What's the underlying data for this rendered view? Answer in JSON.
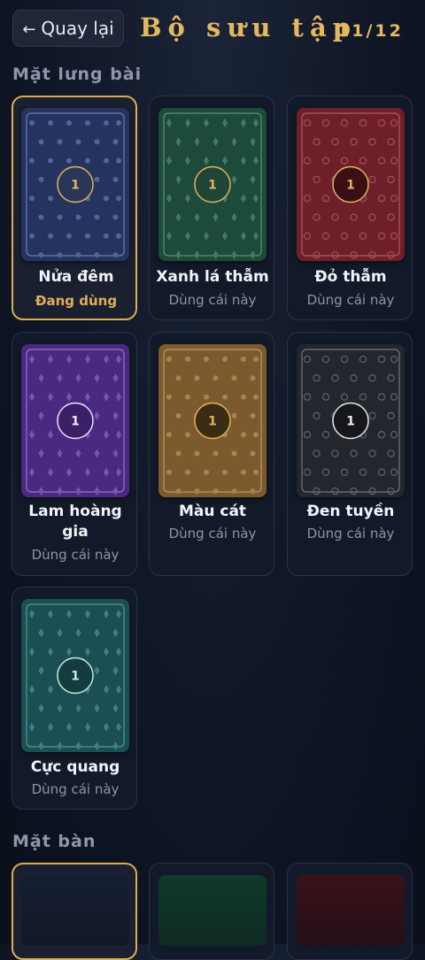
{
  "header": {
    "back_arrow": "←",
    "back_label": "Quay lại",
    "title": "Bộ sưu tập",
    "counter": "11/12"
  },
  "sections": {
    "card_backs": "Mặt lưng bài",
    "tables": "Mặt bàn"
  },
  "card_backs": [
    {
      "name": "Nửa đêm",
      "status": "Đang dùng",
      "emblem": "1",
      "pattern": "dot",
      "colors": {
        "bg": "#24345e",
        "pat": "#51659a",
        "border": "#6f86c4",
        "emblem_bg": "#2a3658",
        "emblem_ring": "#e0b45c",
        "emblem_text": "#e0b45c"
      }
    },
    {
      "name": "Xanh lá thẫm",
      "status": "Dùng cái này",
      "emblem": "1",
      "pattern": "diamond",
      "colors": {
        "bg": "#1e4a3a",
        "pat": "#3f7c63",
        "border": "#5e9b80",
        "emblem_bg": "#1f4536",
        "emblem_ring": "#e0b45c",
        "emblem_text": "#e0b45c"
      }
    },
    {
      "name": "Đỏ thẫm",
      "status": "Dùng cái này",
      "emblem": "1",
      "pattern": "ring",
      "colors": {
        "bg": "#6e1f2a",
        "pat": "#a14c57",
        "border": "#b8606b",
        "emblem_bg": "#3a1016",
        "emblem_ring": "#e0b45c",
        "emblem_text": "#e0b45c"
      }
    },
    {
      "name": "Lam hoàng gia",
      "status": "Dùng cái này",
      "emblem": "1",
      "pattern": "diamond",
      "colors": {
        "bg": "#4a2a80",
        "pat": "#7656ad",
        "border": "#9b80cf",
        "emblem_bg": "#3b2068",
        "emblem_ring": "#e8e2f4",
        "emblem_text": "#ece8f6"
      }
    },
    {
      "name": "Màu cát",
      "status": "Dùng cái này",
      "emblem": "1",
      "pattern": "dot",
      "colors": {
        "bg": "#7d5a2e",
        "pat": "#a88352",
        "border": "#c29f70",
        "emblem_bg": "#3a2c15",
        "emblem_ring": "#e0b45c",
        "emblem_text": "#e0b45c"
      }
    },
    {
      "name": "Đen tuyền",
      "status": "Dùng cái này",
      "emblem": "1",
      "pattern": "ring",
      "colors": {
        "bg": "#23262c",
        "pat": "#5b6068",
        "border": "#7a7f88",
        "emblem_bg": "#15171b",
        "emblem_ring": "#e6e8ec",
        "emblem_text": "#eceef2"
      }
    },
    {
      "name": "Cực quang",
      "status": "Dùng cái này",
      "emblem": "1",
      "pattern": "diamond",
      "colors": {
        "bg": "#1b4f53",
        "pat": "#3d8084",
        "border": "#5aa3a3",
        "emblem_bg": "#143b3e",
        "emblem_ring": "#bfeee8",
        "emblem_text": "#bfeee8"
      }
    }
  ],
  "tables": [
    {
      "colors": {
        "top": "#161f33",
        "bottom": "#111827"
      }
    },
    {
      "colors": {
        "top": "#0f3a2a",
        "bottom": "#0e2a22"
      }
    },
    {
      "colors": {
        "top": "#3a1119",
        "bottom": "#231017"
      }
    }
  ]
}
